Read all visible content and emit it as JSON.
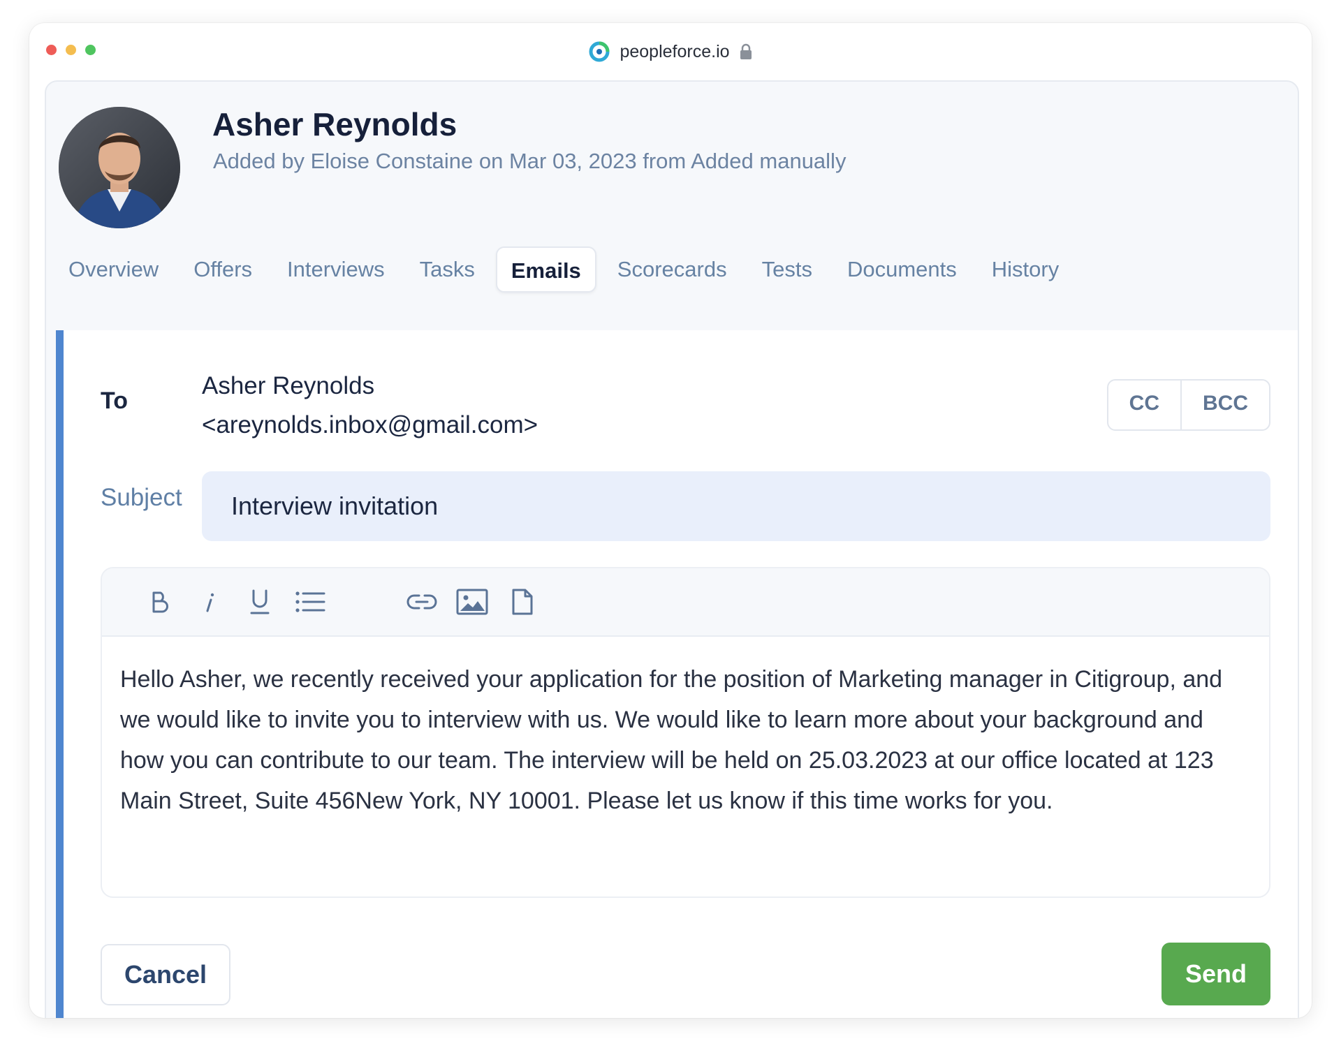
{
  "browser": {
    "url": "peopleforce.io"
  },
  "profile": {
    "name": "Asher Reynolds",
    "meta": "Added by Eloise Constaine on Mar 03, 2023 from Added manually"
  },
  "tabs": [
    {
      "label": "Overview"
    },
    {
      "label": "Offers"
    },
    {
      "label": "Interviews"
    },
    {
      "label": "Tasks"
    },
    {
      "label": "Emails",
      "active": true
    },
    {
      "label": "Scorecards"
    },
    {
      "label": "Tests"
    },
    {
      "label": "Documents"
    },
    {
      "label": "History"
    }
  ],
  "compose": {
    "to_label": "To",
    "to_name": "Asher Reynolds",
    "to_email": "<areynolds.inbox@gmail.com>",
    "cc_label": "CC",
    "bcc_label": "BCC",
    "subject_label": "Subject",
    "subject_value": "Interview invitation",
    "toolbar_icons": [
      "bold-icon",
      "italic-icon",
      "underline-icon",
      "bulleted-list-icon",
      "link-icon",
      "image-icon",
      "file-icon"
    ],
    "body": "Hello Asher, we recently received your application for the position of Marketing manager in Citigroup, and we would like to invite you to interview with us. We would like to learn more about your background and how you can contribute to our team. The interview will be held on 25.03.2023 at our office located at 123 Main Street, Suite 456New York, NY 10001. Please let us know if this time works for you.",
    "cancel_label": "Cancel",
    "send_label": "Send"
  },
  "colors": {
    "accent_bar": "#4f86cf",
    "send_button": "#58a94f",
    "subject_bg": "#e9effb"
  }
}
